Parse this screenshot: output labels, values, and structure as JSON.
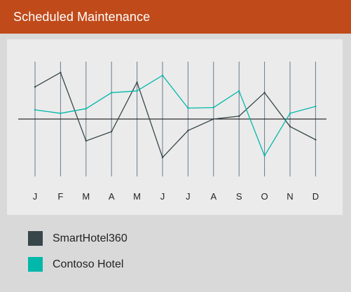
{
  "header": {
    "title": "Scheduled Maintenance"
  },
  "colors": {
    "header_bg": "#c04a1a",
    "series_1": "#374649",
    "series_2": "#01b8aa",
    "gridline": "#6a7b8c",
    "baseline": "#000000"
  },
  "chart_data": {
    "type": "line",
    "title": "",
    "xlabel": "",
    "ylabel": "",
    "categories": [
      "J",
      "F",
      "M",
      "A",
      "M",
      "J",
      "J",
      "A",
      "S",
      "O",
      "N",
      "D"
    ],
    "ylim": [
      -10,
      10
    ],
    "baseline": 0,
    "grid": "vertical",
    "legend": "bottom-left",
    "series": [
      {
        "name": "SmartHotel360",
        "color": "#374649",
        "values": [
          5.6,
          8.1,
          -3.8,
          -2.2,
          6.4,
          -6.7,
          -2.0,
          0.0,
          0.5,
          4.6,
          -1.3,
          -3.6
        ]
      },
      {
        "name": "Contoso Hotel",
        "color": "#01b8aa",
        "values": [
          1.6,
          1.0,
          1.8,
          4.6,
          4.9,
          7.6,
          1.9,
          2.0,
          4.9,
          -6.4,
          1.0,
          2.2
        ]
      }
    ]
  }
}
